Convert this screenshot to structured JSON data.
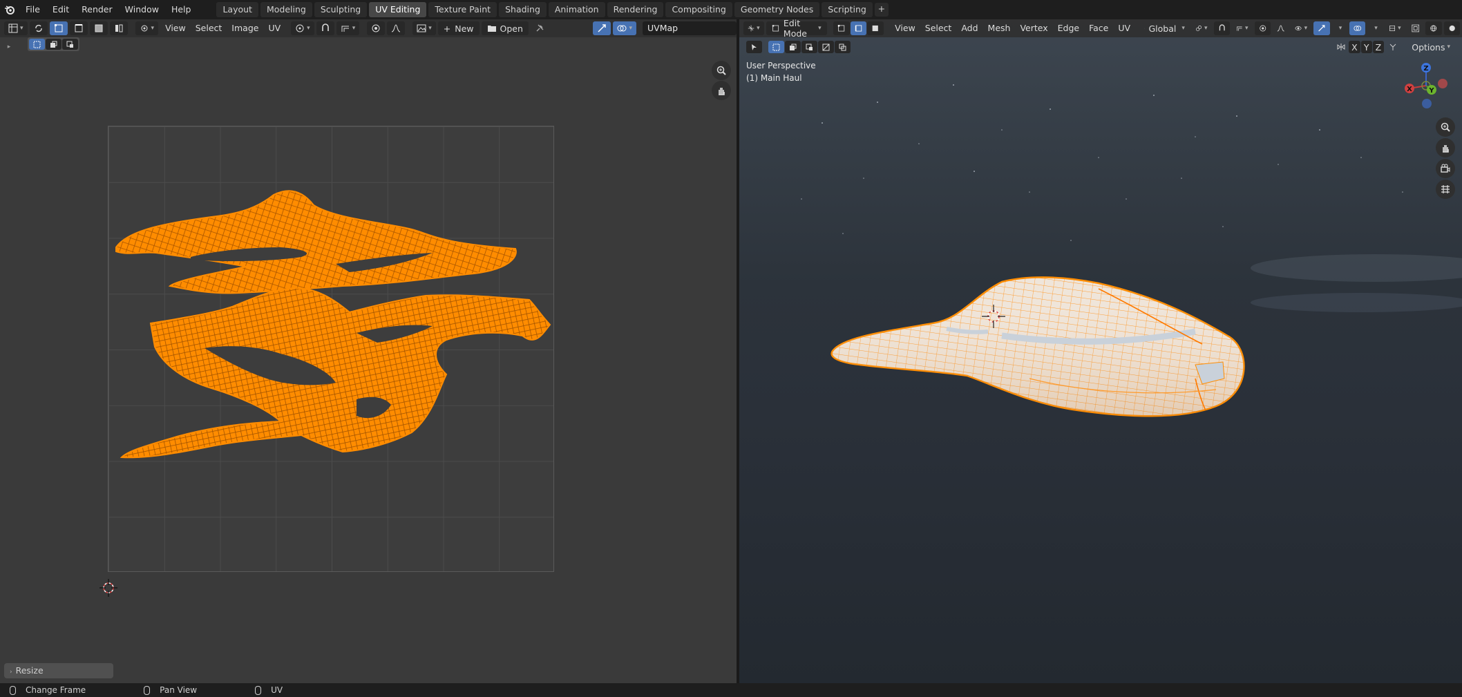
{
  "topbar": {
    "menus": [
      "File",
      "Edit",
      "Render",
      "Window",
      "Help"
    ],
    "workspaces": [
      "Layout",
      "Modeling",
      "Sculpting",
      "UV Editing",
      "Texture Paint",
      "Shading",
      "Animation",
      "Rendering",
      "Compositing",
      "Geometry Nodes",
      "Scripting"
    ],
    "active_workspace": "UV Editing",
    "add_tab": "+"
  },
  "uv_editor": {
    "menus": [
      "View",
      "Select",
      "Image",
      "UV"
    ],
    "new_label": "New",
    "open_label": "Open",
    "uv_map": "UVMap",
    "redo_panel": "Resize"
  },
  "viewport": {
    "mode": "Edit Mode",
    "menus": [
      "View",
      "Select",
      "Add",
      "Mesh",
      "Vertex",
      "Edge",
      "Face",
      "UV"
    ],
    "transform_orientation": "Global",
    "perspective_label": "User Perspective",
    "object_label": "(1) Main Haul",
    "axes": [
      "X",
      "Y",
      "Z"
    ],
    "options_label": "Options",
    "gizmo": {
      "x": "X",
      "y": "Y",
      "z": "Z"
    }
  },
  "statusbar": {
    "items": [
      "Change Frame",
      "Pan View",
      "UV"
    ]
  },
  "colors": {
    "selection_orange": "#ff8c00",
    "active_blue": "#4772b3"
  }
}
